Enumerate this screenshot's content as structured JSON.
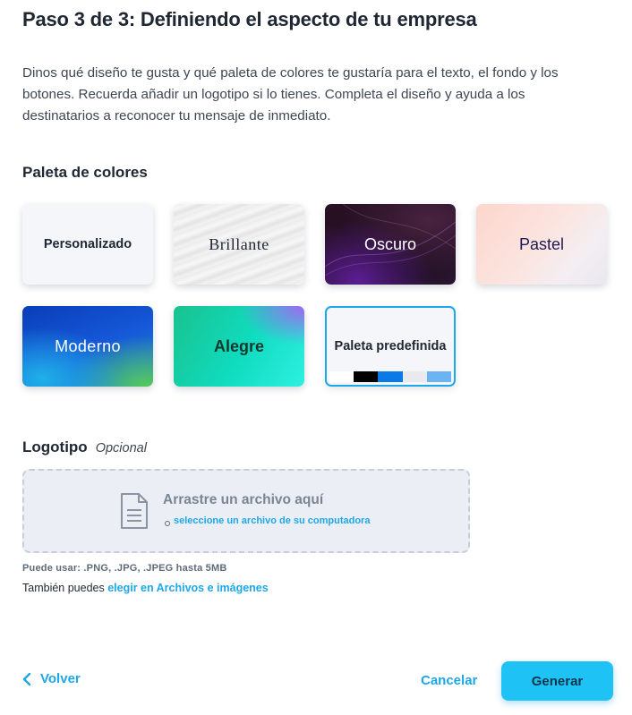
{
  "header": {
    "title": "Paso 3 de 3: Definiendo el aspecto de tu empresa",
    "description": "Dinos qué diseño te gusta y qué paleta de colores te gustaría para el texto, el fondo y los botones. Recuerda añadir un logotipo si lo tienes. Completa el diseño y ayuda a los destinatarios a reconocer tu mensaje de inmediato."
  },
  "palette": {
    "heading": "Paleta de colores",
    "options": [
      {
        "label": "Personalizado"
      },
      {
        "label": "Brillante"
      },
      {
        "label": "Oscuro"
      },
      {
        "label": "Pastel"
      },
      {
        "label": "Moderno"
      },
      {
        "label": "Alegre"
      },
      {
        "label": "Paleta predefinida",
        "selected": true,
        "swatches": [
          "#ffffff",
          "#000000",
          "#0a7ae8",
          "#e8eaed",
          "#6ab4f4"
        ]
      }
    ]
  },
  "logo": {
    "heading": "Logotipo",
    "optional_label": "Opcional",
    "drop_title": "Arrastre un archivo aquí",
    "drop_link": "seleccione un archivo de su computadora",
    "allowed": "Puede usar: .PNG, .JPG, .JPEG hasta 5MB",
    "also_text": "También puedes",
    "also_link": "elegir en Archivos e imágenes"
  },
  "footer": {
    "back_label": "Volver",
    "cancel_label": "Cancelar",
    "generate_label": "Generar"
  },
  "colors": {
    "accent": "#1ea7e8",
    "primary_button": "#1ec2f5",
    "text": "#1f2733"
  }
}
